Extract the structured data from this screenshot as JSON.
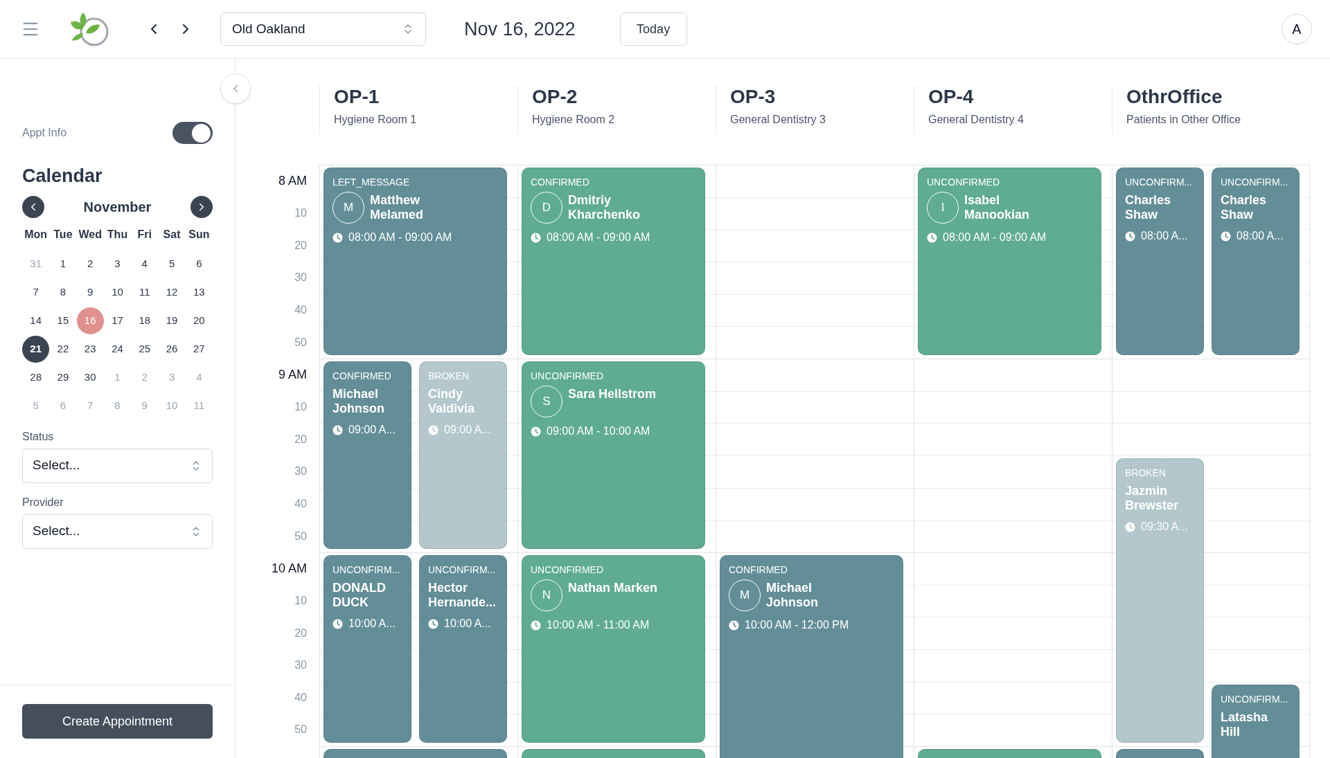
{
  "header": {
    "location": "Old Oakland",
    "date": "Nov 16, 2022",
    "today_button": "Today",
    "avatar": "A"
  },
  "sidebar": {
    "appt_info": {
      "label": "Appt Info",
      "on": true
    },
    "calendar_title": "Calendar",
    "month": "November",
    "weekdays": [
      "Mon",
      "Tue",
      "Wed",
      "Thu",
      "Fri",
      "Sat",
      "Sun"
    ],
    "days": [
      {
        "label": "31",
        "muted": true,
        "today": false,
        "selected": false
      },
      {
        "label": "1",
        "muted": false,
        "today": false,
        "selected": false
      },
      {
        "label": "2",
        "muted": false,
        "today": false,
        "selected": false
      },
      {
        "label": "3",
        "muted": false,
        "today": false,
        "selected": false
      },
      {
        "label": "4",
        "muted": false,
        "today": false,
        "selected": false
      },
      {
        "label": "5",
        "muted": false,
        "today": false,
        "selected": false
      },
      {
        "label": "6",
        "muted": false,
        "today": false,
        "selected": false
      },
      {
        "label": "7",
        "muted": false,
        "today": false,
        "selected": false
      },
      {
        "label": "8",
        "muted": false,
        "today": false,
        "selected": false
      },
      {
        "label": "9",
        "muted": false,
        "today": false,
        "selected": false
      },
      {
        "label": "10",
        "muted": false,
        "today": false,
        "selected": false
      },
      {
        "label": "11",
        "muted": false,
        "today": false,
        "selected": false
      },
      {
        "label": "12",
        "muted": false,
        "today": false,
        "selected": false
      },
      {
        "label": "13",
        "muted": false,
        "today": false,
        "selected": false
      },
      {
        "label": "14",
        "muted": false,
        "today": false,
        "selected": false
      },
      {
        "label": "15",
        "muted": false,
        "today": false,
        "selected": false
      },
      {
        "label": "16",
        "muted": false,
        "today": true,
        "selected": false
      },
      {
        "label": "17",
        "muted": false,
        "today": false,
        "selected": false
      },
      {
        "label": "18",
        "muted": false,
        "today": false,
        "selected": false
      },
      {
        "label": "19",
        "muted": false,
        "today": false,
        "selected": false
      },
      {
        "label": "20",
        "muted": false,
        "today": false,
        "selected": false
      },
      {
        "label": "21",
        "muted": false,
        "today": false,
        "selected": true
      },
      {
        "label": "22",
        "muted": false,
        "today": false,
        "selected": false
      },
      {
        "label": "23",
        "muted": false,
        "today": false,
        "selected": false
      },
      {
        "label": "24",
        "muted": false,
        "today": false,
        "selected": false
      },
      {
        "label": "25",
        "muted": false,
        "today": false,
        "selected": false
      },
      {
        "label": "26",
        "muted": false,
        "today": false,
        "selected": false
      },
      {
        "label": "27",
        "muted": false,
        "today": false,
        "selected": false
      },
      {
        "label": "28",
        "muted": false,
        "today": false,
        "selected": false
      },
      {
        "label": "29",
        "muted": false,
        "today": false,
        "selected": false
      },
      {
        "label": "30",
        "muted": false,
        "today": false,
        "selected": false
      },
      {
        "label": "1",
        "muted": true,
        "today": false,
        "selected": false
      },
      {
        "label": "2",
        "muted": true,
        "today": false,
        "selected": false
      },
      {
        "label": "3",
        "muted": true,
        "today": false,
        "selected": false
      },
      {
        "label": "4",
        "muted": true,
        "today": false,
        "selected": false
      },
      {
        "label": "5",
        "muted": true,
        "today": false,
        "selected": false
      },
      {
        "label": "6",
        "muted": true,
        "today": false,
        "selected": false
      },
      {
        "label": "7",
        "muted": true,
        "today": false,
        "selected": false
      },
      {
        "label": "8",
        "muted": true,
        "today": false,
        "selected": false
      },
      {
        "label": "9",
        "muted": true,
        "today": false,
        "selected": false
      },
      {
        "label": "10",
        "muted": true,
        "today": false,
        "selected": false
      },
      {
        "label": "11",
        "muted": true,
        "today": false,
        "selected": false
      }
    ],
    "filters": [
      {
        "label": "Status",
        "value": "Select..."
      },
      {
        "label": "Provider",
        "value": "Select..."
      }
    ],
    "create_button": "Create Appointment"
  },
  "hours": [
    {
      "label": "8 AM",
      "minutes": [
        "10",
        "20",
        "30",
        "40",
        "50"
      ]
    },
    {
      "label": "9 AM",
      "minutes": [
        "10",
        "20",
        "30",
        "40",
        "50"
      ]
    },
    {
      "label": "10 AM",
      "minutes": [
        "10",
        "20",
        "30",
        "40",
        "50"
      ]
    }
  ],
  "columns": [
    {
      "title": "OP-1",
      "subtitle": "Hygiene Room 1",
      "lanes": [
        {
          "kind": "full",
          "items": [
            {
              "kind": "appointment",
              "status": "LEFT_MESSAGE",
              "avatar": "M",
              "name": [
                "Matthew",
                "Melamed"
              ],
              "time": "08:00 AM - 09:00 AM",
              "color": "#638e97"
            },
            {
              "kind": "more"
            },
            {
              "kind": "more"
            },
            {
              "kind": "more"
            },
            {
              "kind": "more"
            },
            {
              "kind": "more"
            },
            {
              "kind": "free"
            },
            {
              "kind": "free"
            },
            {
              "kind": "free"
            },
            {
              "kind": "free"
            },
            {
              "kind": "free"
            },
            {
              "kind": "free"
            },
            {
              "kind": "free"
            },
            {
              "kind": "free"
            },
            {
              "kind": "free"
            },
            {
              "kind": "free"
            },
            {
              "kind": "free"
            },
            {
              "kind": "free"
            },
            {
              "kind": "appointment",
              "color": "#638e97"
            }
          ]
        },
        {
          "kind": "left",
          "items": [
            {
              "kind": "free"
            },
            {
              "kind": "free"
            },
            {
              "kind": "free"
            },
            {
              "kind": "free"
            },
            {
              "kind": "free"
            },
            {
              "kind": "free"
            },
            {
              "kind": "appointment",
              "status": "CONFIRMED",
              "name": [
                "Michael",
                "Johnson"
              ],
              "time": "09:00 A...",
              "color": "#638e97"
            },
            {
              "kind": "more"
            },
            {
              "kind": "more"
            },
            {
              "kind": "more"
            },
            {
              "kind": "more"
            },
            {
              "kind": "more"
            },
            {
              "kind": "appointment",
              "status": "UNCONFIRM...",
              "name": [
                "DONALD",
                "DUCK"
              ],
              "time": "10:00 A...",
              "color": "#638e97"
            },
            {
              "kind": "more"
            },
            {
              "kind": "more"
            },
            {
              "kind": "more"
            },
            {
              "kind": "more"
            },
            {
              "kind": "more"
            }
          ]
        },
        {
          "kind": "right",
          "items": [
            {
              "kind": "free"
            },
            {
              "kind": "free"
            },
            {
              "kind": "free"
            },
            {
              "kind": "free"
            },
            {
              "kind": "free"
            },
            {
              "kind": "free"
            },
            {
              "kind": "appointment",
              "status": "BROKEN",
              "name": [
                "Cindy",
                "Valdivia"
              ],
              "time": "09:00 A...",
              "color": "#b3c7cc"
            },
            {
              "kind": "more"
            },
            {
              "kind": "more"
            },
            {
              "kind": "more"
            },
            {
              "kind": "more"
            },
            {
              "kind": "more"
            },
            {
              "kind": "appointment",
              "status": "UNCONFIRM...",
              "name": [
                "Hector",
                "Hernande..."
              ],
              "time": "10:00 A...",
              "color": "#638e97"
            },
            {
              "kind": "more"
            },
            {
              "kind": "more"
            },
            {
              "kind": "more"
            },
            {
              "kind": "more"
            },
            {
              "kind": "more"
            }
          ]
        }
      ]
    },
    {
      "title": "OP-2",
      "subtitle": "Hygiene Room 2",
      "lanes": [
        {
          "kind": "full",
          "items": [
            {
              "kind": "appointment",
              "status": "CONFIRMED",
              "avatar": "D",
              "name": [
                "Dmitriy",
                "Kharchenko"
              ],
              "time": "08:00 AM - 09:00 AM",
              "color": "#5fab94"
            },
            {
              "kind": "more"
            },
            {
              "kind": "more"
            },
            {
              "kind": "more"
            },
            {
              "kind": "more"
            },
            {
              "kind": "more"
            },
            {
              "kind": "appointment",
              "status": "UNCONFIRMED",
              "avatar": "S",
              "name": [
                "Sara Hellstrom"
              ],
              "time": "09:00 AM - 10:00 AM",
              "color": "#5fab94"
            },
            {
              "kind": "more"
            },
            {
              "kind": "more"
            },
            {
              "kind": "more"
            },
            {
              "kind": "more"
            },
            {
              "kind": "more"
            },
            {
              "kind": "appointment",
              "status": "UNCONFIRMED",
              "avatar": "N",
              "name": [
                "Nathan Marken"
              ],
              "time": "10:00 AM - 11:00 AM",
              "color": "#5fab94"
            },
            {
              "kind": "more"
            },
            {
              "kind": "more"
            },
            {
              "kind": "more"
            },
            {
              "kind": "more"
            },
            {
              "kind": "more"
            },
            {
              "kind": "appointment",
              "color": "#5fab94"
            }
          ]
        }
      ]
    },
    {
      "title": "OP-3",
      "subtitle": "General Dentistry 3",
      "lanes": [
        {
          "kind": "full",
          "items": [
            {
              "kind": "free"
            },
            {
              "kind": "free"
            },
            {
              "kind": "free"
            },
            {
              "kind": "free"
            },
            {
              "kind": "free"
            },
            {
              "kind": "free"
            },
            {
              "kind": "free"
            },
            {
              "kind": "free"
            },
            {
              "kind": "free"
            },
            {
              "kind": "free"
            },
            {
              "kind": "free"
            },
            {
              "kind": "free"
            },
            {
              "kind": "appointment",
              "status": "CONFIRMED",
              "avatar": "M",
              "name": [
                "Michael",
                "Johnson"
              ],
              "time": "10:00 AM - 12:00 PM",
              "color": "#638e97"
            },
            {
              "kind": "more"
            },
            {
              "kind": "more"
            },
            {
              "kind": "more"
            },
            {
              "kind": "more"
            },
            {
              "kind": "more"
            },
            {
              "kind": "more"
            },
            {
              "kind": "more"
            }
          ]
        }
      ]
    },
    {
      "title": "OP-4",
      "subtitle": "General Dentistry 4",
      "lanes": [
        {
          "kind": "full",
          "items": [
            {
              "kind": "appointment",
              "status": "UNCONFIRMED",
              "avatar": "I",
              "name": [
                "Isabel",
                "Manookian"
              ],
              "time": "08:00 AM - 09:00 AM",
              "color": "#5fab94"
            },
            {
              "kind": "more"
            },
            {
              "kind": "more"
            },
            {
              "kind": "more"
            },
            {
              "kind": "more"
            },
            {
              "kind": "more"
            },
            {
              "kind": "free"
            },
            {
              "kind": "free"
            },
            {
              "kind": "free"
            },
            {
              "kind": "free"
            },
            {
              "kind": "free"
            },
            {
              "kind": "free"
            },
            {
              "kind": "free"
            },
            {
              "kind": "free"
            },
            {
              "kind": "free"
            },
            {
              "kind": "free"
            },
            {
              "kind": "free"
            },
            {
              "kind": "free"
            },
            {
              "kind": "appointment",
              "color": "#5fab94"
            }
          ]
        }
      ]
    },
    {
      "title": "OthrOffice",
      "subtitle": "Patients in Other Office",
      "lanes": [
        {
          "kind": "left",
          "items": [
            {
              "kind": "appointment",
              "status": "UNCONFIRM...",
              "name": [
                "Charles",
                "Shaw"
              ],
              "time": "08:00 A...",
              "color": "#638e97"
            },
            {
              "kind": "more"
            },
            {
              "kind": "more"
            },
            {
              "kind": "more"
            },
            {
              "kind": "more"
            },
            {
              "kind": "more"
            },
            {
              "kind": "free"
            },
            {
              "kind": "free"
            },
            {
              "kind": "free"
            },
            {
              "kind": "appointment",
              "status": "BROKEN",
              "name": [
                "Jazmin",
                "Brewster"
              ],
              "time": "09:30 A...",
              "color": "#b3c7cc"
            },
            {
              "kind": "more"
            },
            {
              "kind": "more"
            },
            {
              "kind": "more"
            },
            {
              "kind": "more"
            },
            {
              "kind": "more"
            },
            {
              "kind": "more"
            },
            {
              "kind": "more"
            },
            {
              "kind": "more"
            },
            {
              "kind": "appointment",
              "color": "#638e97"
            }
          ]
        },
        {
          "kind": "right",
          "items": [
            {
              "kind": "appointment",
              "status": "UNCONFIRM...",
              "name": [
                "Charles",
                "Shaw"
              ],
              "time": "08:00 A...",
              "color": "#638e97"
            },
            {
              "kind": "more"
            },
            {
              "kind": "more"
            },
            {
              "kind": "more"
            },
            {
              "kind": "more"
            },
            {
              "kind": "more"
            },
            {
              "kind": "free"
            },
            {
              "kind": "free"
            },
            {
              "kind": "free"
            },
            {
              "kind": "free"
            },
            {
              "kind": "free"
            },
            {
              "kind": "free"
            },
            {
              "kind": "free"
            },
            {
              "kind": "free"
            },
            {
              "kind": "free"
            },
            {
              "kind": "free"
            },
            {
              "kind": "appointment",
              "status": "UNCONFIRM...",
              "name": [
                "Latasha",
                "Hill"
              ],
              "color": "#638e97"
            },
            {
              "kind": "more"
            },
            {
              "kind": "more"
            },
            {
              "kind": "more"
            },
            {
              "kind": "more"
            },
            {
              "kind": "more"
            }
          ]
        }
      ]
    }
  ]
}
